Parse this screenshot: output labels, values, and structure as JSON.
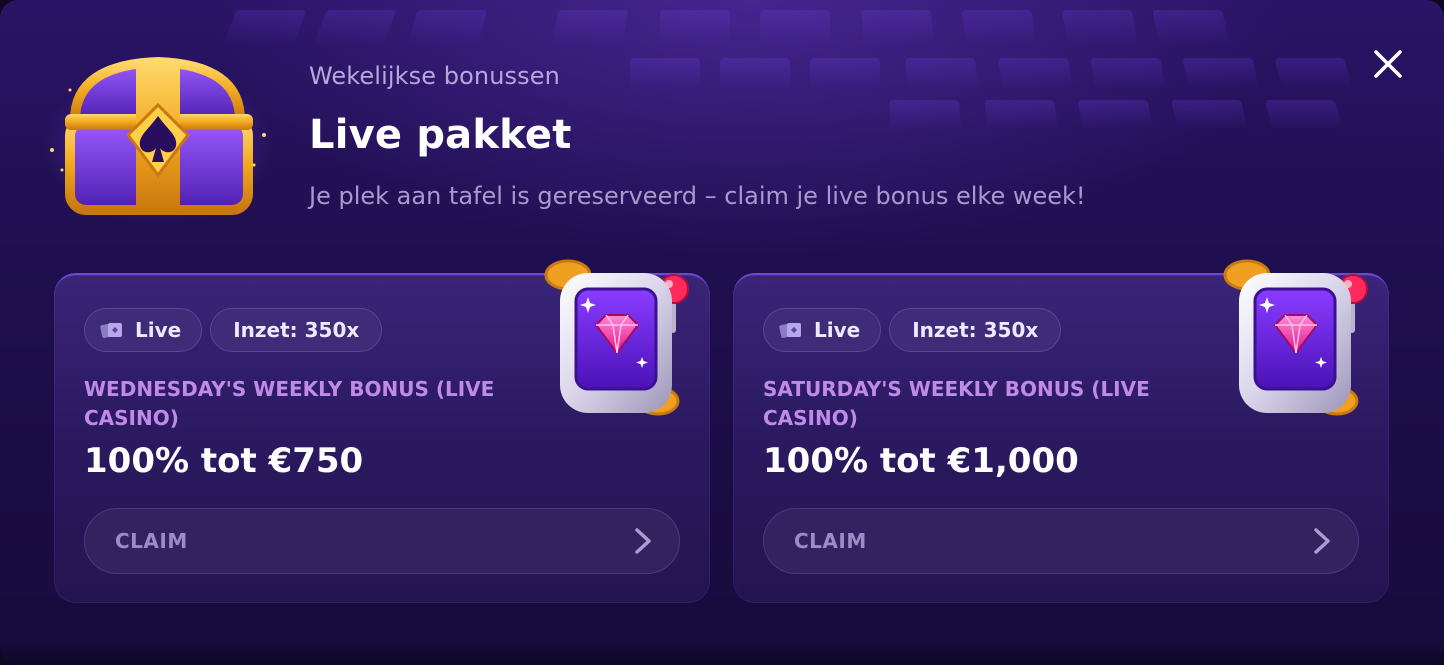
{
  "header": {
    "kicker": "Wekelijkse bonussen",
    "title": "Live pakket",
    "subtitle": "Je plek aan tafel is gereserveerd – claim je live bonus elke week!"
  },
  "icons": {
    "chest": "treasure-chest-icon",
    "close": "close-icon",
    "slot": "slot-machine-icon",
    "live": "cards-icon",
    "chevron": "chevron-right-icon"
  },
  "colors": {
    "accent": "#c08ae8",
    "background": "#1f0f50",
    "card": "#2c1a62"
  },
  "cards": [
    {
      "tag_live": "Live",
      "tag_wager": "Inzet: 350x",
      "name": "Wednesday's weekly bonus (live casino)",
      "amount": "100% tot €750",
      "button": "CLAIM"
    },
    {
      "tag_live": "Live",
      "tag_wager": "Inzet: 350x",
      "name": "Saturday's weekly bonus (live casino)",
      "amount": "100% tot €1,000",
      "button": "CLAIM"
    }
  ]
}
